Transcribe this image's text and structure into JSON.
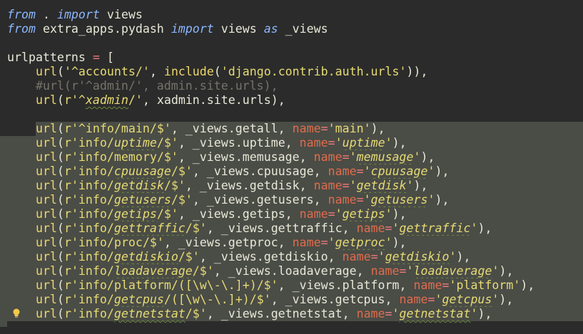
{
  "editor": {
    "colors": {
      "background": "#2b2b2b",
      "highlight": "#4a4c46",
      "keyword": "#8ab6ff",
      "string": "#e6db74",
      "kwarg": "#e06c4c",
      "comment": "#75736a",
      "text": "#e8e8d8"
    },
    "lines": [
      {
        "tokens": [
          {
            "t": "kw",
            "v": "from"
          },
          {
            "t": "plain",
            "v": " . "
          },
          {
            "t": "kw",
            "v": "import"
          },
          {
            "t": "plain",
            "v": " views"
          }
        ]
      },
      {
        "tokens": [
          {
            "t": "kw",
            "v": "from"
          },
          {
            "t": "plain",
            "v": " extra_apps.pydash "
          },
          {
            "t": "kw",
            "v": "import"
          },
          {
            "t": "plain",
            "v": " views "
          },
          {
            "t": "kw",
            "v": "as"
          },
          {
            "t": "plain",
            "v": " _views"
          }
        ]
      },
      {
        "tokens": []
      },
      {
        "tokens": [
          {
            "t": "plain",
            "v": "urlpatterns "
          },
          {
            "t": "op",
            "v": "="
          },
          {
            "t": "plain",
            "v": " ["
          }
        ]
      },
      {
        "tokens": [
          {
            "t": "plain",
            "v": "    "
          },
          {
            "t": "fn",
            "v": "url"
          },
          {
            "t": "plain",
            "v": "("
          },
          {
            "t": "str",
            "v": "'^accounts/'"
          },
          {
            "t": "plain",
            "v": ", "
          },
          {
            "t": "fn",
            "v": "include"
          },
          {
            "t": "plain",
            "v": "("
          },
          {
            "t": "str",
            "v": "'django.contrib.auth.urls'"
          },
          {
            "t": "plain",
            "v": ")),"
          }
        ]
      },
      {
        "tokens": [
          {
            "t": "plain",
            "v": "    "
          },
          {
            "t": "cm",
            "v": "#url(r'^admin/', admin.site.urls),"
          }
        ]
      },
      {
        "tokens": [
          {
            "t": "plain",
            "v": "    "
          },
          {
            "t": "fn",
            "v": "url"
          },
          {
            "t": "plain",
            "v": "("
          },
          {
            "t": "pfx",
            "v": "r'^"
          },
          {
            "t": "strs",
            "v": "xadmin"
          },
          {
            "t": "pfx",
            "v": "/'"
          },
          {
            "t": "plain",
            "v": ", xadmin.site.urls),"
          }
        ]
      },
      {
        "tokens": []
      },
      {
        "hl": true,
        "tokens": [
          {
            "t": "plain",
            "v": "    "
          },
          {
            "t": "fn",
            "v": "url"
          },
          {
            "t": "plain",
            "v": "("
          },
          {
            "t": "pfx",
            "v": "r'^info/main/$'"
          },
          {
            "t": "plain",
            "v": ", _views.getall, "
          },
          {
            "t": "kwarg",
            "v": "name"
          },
          {
            "t": "op",
            "v": "="
          },
          {
            "t": "str",
            "v": "'main'"
          },
          {
            "t": "plain",
            "v": "),"
          }
        ]
      },
      {
        "hl": true,
        "tokens": [
          {
            "t": "plain",
            "v": "    "
          },
          {
            "t": "fn",
            "v": "url"
          },
          {
            "t": "plain",
            "v": "("
          },
          {
            "t": "pfx",
            "v": "r'info/"
          },
          {
            "t": "strs",
            "v": "uptime"
          },
          {
            "t": "pfx",
            "v": "/$'"
          },
          {
            "t": "plain",
            "v": ", _views.uptime, "
          },
          {
            "t": "kwarg",
            "v": "name"
          },
          {
            "t": "op",
            "v": "="
          },
          {
            "t": "pfx",
            "v": "'"
          },
          {
            "t": "strs",
            "v": "uptime"
          },
          {
            "t": "pfx",
            "v": "'"
          },
          {
            "t": "plain",
            "v": "),"
          }
        ]
      },
      {
        "hl": true,
        "tokens": [
          {
            "t": "plain",
            "v": "    "
          },
          {
            "t": "fn",
            "v": "url"
          },
          {
            "t": "plain",
            "v": "("
          },
          {
            "t": "pfx",
            "v": "r'info/memory/$'"
          },
          {
            "t": "plain",
            "v": ", _views.memusage, "
          },
          {
            "t": "kwarg",
            "v": "name"
          },
          {
            "t": "op",
            "v": "="
          },
          {
            "t": "pfx",
            "v": "'"
          },
          {
            "t": "strs",
            "v": "memusage"
          },
          {
            "t": "pfx",
            "v": "'"
          },
          {
            "t": "plain",
            "v": "),"
          }
        ]
      },
      {
        "hl": true,
        "tokens": [
          {
            "t": "plain",
            "v": "    "
          },
          {
            "t": "fn",
            "v": "url"
          },
          {
            "t": "plain",
            "v": "("
          },
          {
            "t": "pfx",
            "v": "r'info/"
          },
          {
            "t": "strs",
            "v": "cpuusage"
          },
          {
            "t": "pfx",
            "v": "/$'"
          },
          {
            "t": "plain",
            "v": ", _views.cpuusage, "
          },
          {
            "t": "kwarg",
            "v": "name"
          },
          {
            "t": "op",
            "v": "="
          },
          {
            "t": "pfx",
            "v": "'"
          },
          {
            "t": "strs",
            "v": "cpuusage"
          },
          {
            "t": "pfx",
            "v": "'"
          },
          {
            "t": "plain",
            "v": "),"
          }
        ]
      },
      {
        "hl": true,
        "tokens": [
          {
            "t": "plain",
            "v": "    "
          },
          {
            "t": "fn",
            "v": "url"
          },
          {
            "t": "plain",
            "v": "("
          },
          {
            "t": "pfx",
            "v": "r'info/"
          },
          {
            "t": "strs",
            "v": "getdisk"
          },
          {
            "t": "pfx",
            "v": "/$'"
          },
          {
            "t": "plain",
            "v": ", _views.getdisk, "
          },
          {
            "t": "kwarg",
            "v": "name"
          },
          {
            "t": "op",
            "v": "="
          },
          {
            "t": "pfx",
            "v": "'"
          },
          {
            "t": "strs",
            "v": "getdisk"
          },
          {
            "t": "pfx",
            "v": "'"
          },
          {
            "t": "plain",
            "v": "),"
          }
        ]
      },
      {
        "hl": true,
        "tokens": [
          {
            "t": "plain",
            "v": "    "
          },
          {
            "t": "fn",
            "v": "url"
          },
          {
            "t": "plain",
            "v": "("
          },
          {
            "t": "pfx",
            "v": "r'info/"
          },
          {
            "t": "strs",
            "v": "getusers"
          },
          {
            "t": "pfx",
            "v": "/$'"
          },
          {
            "t": "plain",
            "v": ", _views.getusers, "
          },
          {
            "t": "kwarg",
            "v": "name"
          },
          {
            "t": "op",
            "v": "="
          },
          {
            "t": "pfx",
            "v": "'"
          },
          {
            "t": "strs",
            "v": "getusers"
          },
          {
            "t": "pfx",
            "v": "'"
          },
          {
            "t": "plain",
            "v": "),"
          }
        ]
      },
      {
        "hl": true,
        "tokens": [
          {
            "t": "plain",
            "v": "    "
          },
          {
            "t": "fn",
            "v": "url"
          },
          {
            "t": "plain",
            "v": "("
          },
          {
            "t": "pfx",
            "v": "r'info/"
          },
          {
            "t": "strs",
            "v": "getips"
          },
          {
            "t": "pfx",
            "v": "/$'"
          },
          {
            "t": "plain",
            "v": ", _views.getips, "
          },
          {
            "t": "kwarg",
            "v": "name"
          },
          {
            "t": "op",
            "v": "="
          },
          {
            "t": "pfx",
            "v": "'"
          },
          {
            "t": "strs",
            "v": "getips"
          },
          {
            "t": "pfx",
            "v": "'"
          },
          {
            "t": "plain",
            "v": "),"
          }
        ]
      },
      {
        "hl": true,
        "tokens": [
          {
            "t": "plain",
            "v": "    "
          },
          {
            "t": "fn",
            "v": "url"
          },
          {
            "t": "plain",
            "v": "("
          },
          {
            "t": "pfx",
            "v": "r'info/"
          },
          {
            "t": "strs",
            "v": "gettraffic"
          },
          {
            "t": "pfx",
            "v": "/$'"
          },
          {
            "t": "plain",
            "v": ", _views.gettraffic, "
          },
          {
            "t": "kwarg",
            "v": "name"
          },
          {
            "t": "op",
            "v": "="
          },
          {
            "t": "pfx",
            "v": "'"
          },
          {
            "t": "strs",
            "v": "gettraffic"
          },
          {
            "t": "pfx",
            "v": "'"
          },
          {
            "t": "plain",
            "v": "),"
          }
        ]
      },
      {
        "hl": true,
        "tokens": [
          {
            "t": "plain",
            "v": "    "
          },
          {
            "t": "fn",
            "v": "url"
          },
          {
            "t": "plain",
            "v": "("
          },
          {
            "t": "pfx",
            "v": "r'info/proc/$'"
          },
          {
            "t": "plain",
            "v": ", _views.getproc, "
          },
          {
            "t": "kwarg",
            "v": "name"
          },
          {
            "t": "op",
            "v": "="
          },
          {
            "t": "pfx",
            "v": "'"
          },
          {
            "t": "strs",
            "v": "getproc"
          },
          {
            "t": "pfx",
            "v": "'"
          },
          {
            "t": "plain",
            "v": "),"
          }
        ]
      },
      {
        "hl": true,
        "tokens": [
          {
            "t": "plain",
            "v": "    "
          },
          {
            "t": "fn",
            "v": "url"
          },
          {
            "t": "plain",
            "v": "("
          },
          {
            "t": "pfx",
            "v": "r'info/"
          },
          {
            "t": "strs",
            "v": "getdiskio"
          },
          {
            "t": "pfx",
            "v": "/$'"
          },
          {
            "t": "plain",
            "v": ", _views.getdiskio, "
          },
          {
            "t": "kwarg",
            "v": "name"
          },
          {
            "t": "op",
            "v": "="
          },
          {
            "t": "pfx",
            "v": "'"
          },
          {
            "t": "strs",
            "v": "getdiskio"
          },
          {
            "t": "pfx",
            "v": "'"
          },
          {
            "t": "plain",
            "v": "),"
          }
        ]
      },
      {
        "hl": true,
        "tokens": [
          {
            "t": "plain",
            "v": "    "
          },
          {
            "t": "fn",
            "v": "url"
          },
          {
            "t": "plain",
            "v": "("
          },
          {
            "t": "pfx",
            "v": "r'info/"
          },
          {
            "t": "strs",
            "v": "loadaverage"
          },
          {
            "t": "pfx",
            "v": "/$'"
          },
          {
            "t": "plain",
            "v": ", _views.loadaverage, "
          },
          {
            "t": "kwarg",
            "v": "name"
          },
          {
            "t": "op",
            "v": "="
          },
          {
            "t": "pfx",
            "v": "'"
          },
          {
            "t": "strs",
            "v": "loadaverage"
          },
          {
            "t": "pfx",
            "v": "'"
          },
          {
            "t": "plain",
            "v": "),"
          }
        ]
      },
      {
        "hl": true,
        "tokens": [
          {
            "t": "plain",
            "v": "    "
          },
          {
            "t": "fn",
            "v": "url"
          },
          {
            "t": "plain",
            "v": "("
          },
          {
            "t": "pfx",
            "v": "r'info/platform/([\\w\\-\\.]+)/$'"
          },
          {
            "t": "plain",
            "v": ", _views.platform, "
          },
          {
            "t": "kwarg",
            "v": "name"
          },
          {
            "t": "op",
            "v": "="
          },
          {
            "t": "str",
            "v": "'platform'"
          },
          {
            "t": "plain",
            "v": "),"
          }
        ]
      },
      {
        "hl": true,
        "tokens": [
          {
            "t": "plain",
            "v": "    "
          },
          {
            "t": "fn",
            "v": "url"
          },
          {
            "t": "plain",
            "v": "("
          },
          {
            "t": "pfx",
            "v": "r'info/"
          },
          {
            "t": "strs",
            "v": "getcpus"
          },
          {
            "t": "pfx",
            "v": "/([\\w\\-\\.]+)/$'"
          },
          {
            "t": "plain",
            "v": ", _views.getcpus, "
          },
          {
            "t": "kwarg",
            "v": "name"
          },
          {
            "t": "op",
            "v": "="
          },
          {
            "t": "pfx",
            "v": "'"
          },
          {
            "t": "strs",
            "v": "getcpus"
          },
          {
            "t": "pfx",
            "v": "'"
          },
          {
            "t": "plain",
            "v": "),"
          }
        ]
      },
      {
        "hl": true,
        "bulb": true,
        "tokens": [
          {
            "t": "plain",
            "v": "    "
          },
          {
            "t": "fn",
            "v": "url"
          },
          {
            "t": "plain",
            "v": "("
          },
          {
            "t": "pfx",
            "v": "r'info/"
          },
          {
            "t": "strs",
            "v": "getnetstat"
          },
          {
            "t": "pfx",
            "v": "/$'"
          },
          {
            "t": "plain",
            "v": ", _views.getnetstat, "
          },
          {
            "t": "kwarg",
            "v": "name"
          },
          {
            "t": "op",
            "v": "="
          },
          {
            "t": "pfx",
            "v": "'"
          },
          {
            "t": "strs",
            "v": "getnetstat"
          },
          {
            "t": "pfx",
            "v": "'"
          },
          {
            "t": "plain",
            "v": "),"
          }
        ]
      }
    ],
    "bulb_icon": "lightbulb-icon"
  }
}
